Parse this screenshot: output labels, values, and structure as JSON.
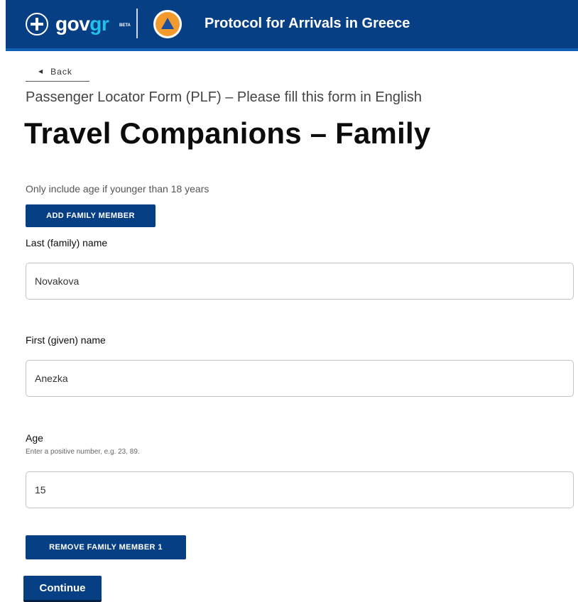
{
  "header": {
    "brand_main": "gov",
    "brand_accent": "gr",
    "brand_badge": "BETA",
    "title": "Protocol for Arrivals in Greece",
    "icons": [
      "greek-emblem-icon",
      "civil-protection-icon"
    ],
    "background_color": "#073f85"
  },
  "nav": {
    "back_label": "Back"
  },
  "page": {
    "subtitle": "Passenger Locator Form (PLF) – Please fill this form in English",
    "title": "Travel Companions – Family",
    "hint": "Only include age if younger than 18 years"
  },
  "buttons": {
    "add_member": "ADD FAMILY MEMBER",
    "remove_member": "REMOVE FAMILY MEMBER 1",
    "continue": "Continue"
  },
  "form": {
    "last_name": {
      "label": "Last (family) name",
      "value": "Novakova"
    },
    "first_name": {
      "label": "First (given) name",
      "value": "Anezka"
    },
    "age": {
      "label": "Age",
      "hint": "Enter a positive number, e.g. 23, 89.",
      "value": "15"
    }
  },
  "colors": {
    "primary": "#073f85",
    "accent": "#22c0ee"
  }
}
